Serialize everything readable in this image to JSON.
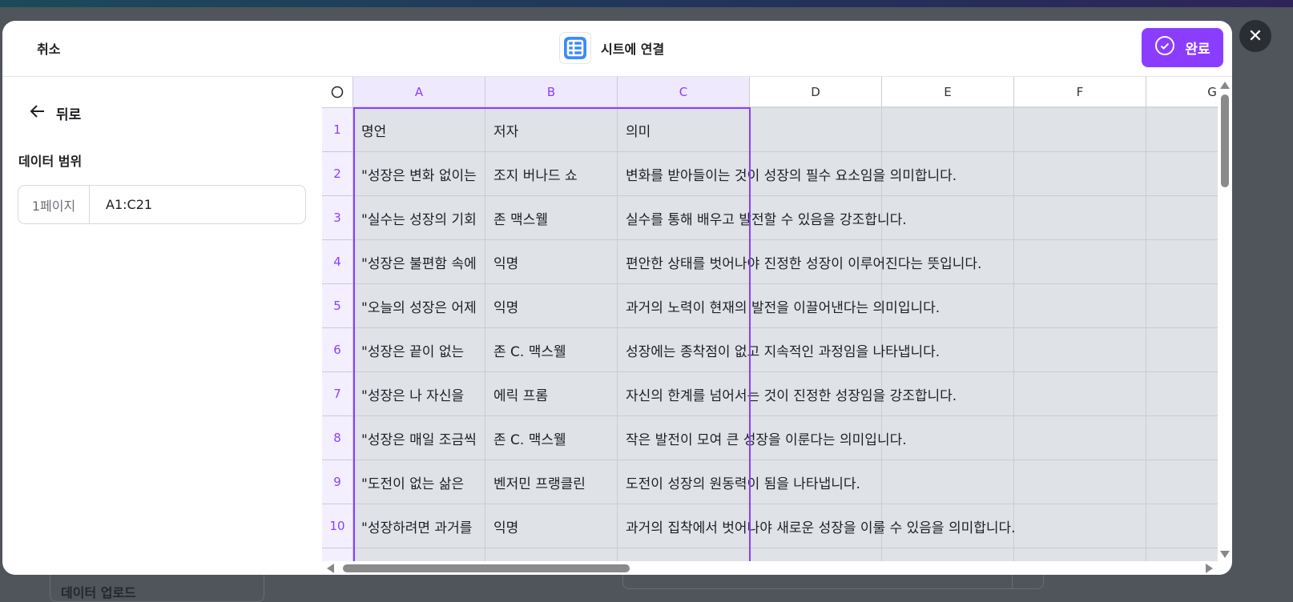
{
  "background": {
    "upload_label": "데이터 업로드"
  },
  "header": {
    "cancel_label": "취소",
    "title": "시트에 연결",
    "title_icon": "sheets-table-icon",
    "done_label": "완료",
    "done_icon": "check-circle-icon",
    "accent_color": "#8b3dff"
  },
  "sidebar": {
    "back_label": "뒤로",
    "range_heading": "데이터 범위",
    "range_page": "1페이지",
    "range_value": "A1:C21"
  },
  "sheet": {
    "columns": [
      "A",
      "B",
      "C",
      "D",
      "E",
      "F",
      "G"
    ],
    "selected_columns": [
      "A",
      "B",
      "C"
    ],
    "rows": [
      {
        "n": "1",
        "cells": [
          "명언",
          "저자",
          "의미"
        ]
      },
      {
        "n": "2",
        "cells": [
          "\"성장은 변화 없이는",
          "조지 버나드 쇼",
          "변화를 받아들이는 것이 성장의 필수 요소임을 의미합니다."
        ]
      },
      {
        "n": "3",
        "cells": [
          "\"실수는 성장의 기회",
          "존 맥스웰",
          "실수를 통해 배우고 발전할 수 있음을 강조합니다."
        ]
      },
      {
        "n": "4",
        "cells": [
          "\"성장은 불편함 속에",
          "익명",
          "편안한 상태를 벗어나야 진정한 성장이 이루어진다는 뜻입니다."
        ]
      },
      {
        "n": "5",
        "cells": [
          "\"오늘의 성장은 어제",
          "익명",
          "과거의 노력이 현재의 발전을 이끌어낸다는 의미입니다."
        ]
      },
      {
        "n": "6",
        "cells": [
          "\"성장은 끝이 없는 ",
          "존 C. 맥스웰",
          "성장에는 종착점이 없고 지속적인 과정임을 나타냅니다."
        ]
      },
      {
        "n": "7",
        "cells": [
          "\"성장은 나 자신을 ",
          "에릭 프롬",
          "자신의 한계를 넘어서는 것이 진정한 성장임을 강조합니다."
        ]
      },
      {
        "n": "8",
        "cells": [
          "\"성장은 매일 조금씩",
          "존 C. 맥스웰",
          "작은 발전이 모여 큰 성장을 이룬다는 의미입니다."
        ]
      },
      {
        "n": "9",
        "cells": [
          "\"도전이 없는 삶은 ",
          "벤저민 프랭클린",
          "도전이 성장의 원동력이 됨을 나타냅니다."
        ]
      },
      {
        "n": "10",
        "cells": [
          "\"성장하려면 과거를",
          "익명",
          "과거의 집착에서 벗어나야 새로운 성장을 이룰 수 있음을 의미합니다."
        ]
      },
      {
        "n": "",
        "cells": [
          "",
          "",
          ""
        ]
      }
    ]
  }
}
